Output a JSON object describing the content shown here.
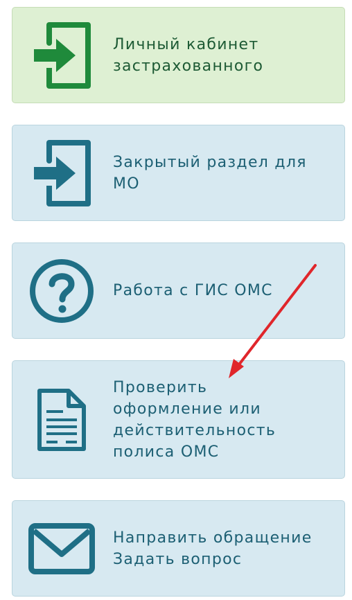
{
  "menu": {
    "items": [
      {
        "lines": [
          "Личный кабинет",
          "застрахованного"
        ],
        "icon": "login-icon",
        "theme": "green"
      },
      {
        "lines": [
          "Закрытый раздел для",
          "МО"
        ],
        "icon": "login-icon",
        "theme": "blue"
      },
      {
        "lines": [
          "Работа с ГИС ОМС"
        ],
        "icon": "question-icon",
        "theme": "blue"
      },
      {
        "lines": [
          "Проверить",
          "оформление или",
          "действительность",
          "полиса ОМС"
        ],
        "icon": "document-icon",
        "theme": "blue"
      },
      {
        "lines": [
          "Направить обращение",
          "Задать вопрос"
        ],
        "icon": "envelope-icon",
        "theme": "blue"
      }
    ]
  },
  "colors": {
    "blue_card_bg": "#d7e9f1",
    "green_card_bg": "#def0d3",
    "blue_text": "#1c5f73",
    "green_text": "#1d5a34",
    "blue_icon": "#1f6f86",
    "green_icon": "#1f8a3b",
    "annotation_arrow": "#e0262b"
  }
}
